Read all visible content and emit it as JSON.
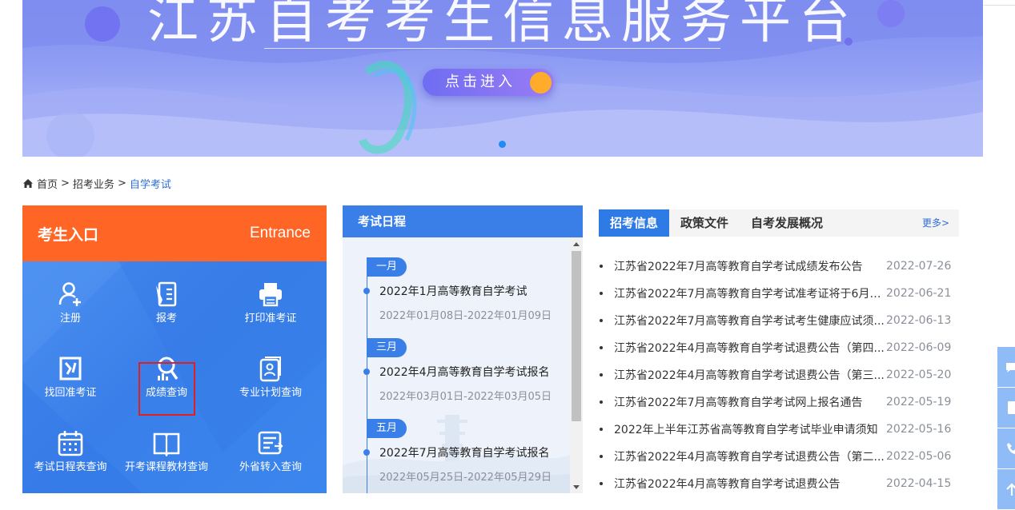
{
  "banner": {
    "title": "江苏自考考生信息服务平台",
    "enter_label": "点击进入"
  },
  "breadcrumb": {
    "items": [
      "首页",
      "招考业务",
      "自学考试"
    ],
    "separator": ">"
  },
  "entrance": {
    "title_cn": "考生入口",
    "title_en": "Entrance",
    "header_color": "#ff6625",
    "body_color": "#3d86ec",
    "tiles": [
      {
        "label": "注册",
        "icon": "user-add-icon"
      },
      {
        "label": "报考",
        "icon": "form-pen-icon"
      },
      {
        "label": "打印准考证",
        "icon": "printer-icon"
      },
      {
        "label": "找回准考证",
        "icon": "retrieve-ticket-icon"
      },
      {
        "label": "成绩查询",
        "icon": "score-search-icon"
      },
      {
        "label": "专业计划查询",
        "icon": "plan-doc-icon"
      },
      {
        "label": "考试日程表查询",
        "icon": "calendar-icon"
      },
      {
        "label": "开考课程教材查询",
        "icon": "book-icon"
      },
      {
        "label": "外省转入查询",
        "icon": "transfer-icon"
      }
    ]
  },
  "schedule": {
    "title": "考试日程",
    "events": [
      {
        "month": "一月",
        "title": "2022年1月高等教育自学考试",
        "date": "2022年01月08日-2022年01月09日"
      },
      {
        "month": "三月",
        "title": "2022年4月高等教育自学考试报名",
        "date": "2022年03月01日-2022年03月05日"
      },
      {
        "month": "五月",
        "title": "2022年7月高等教育自学考试报名",
        "date": "2022年05月25日-2022年05月29日"
      }
    ]
  },
  "news": {
    "tabs": [
      "招考信息",
      "政策文件",
      "自考发展概况"
    ],
    "more_label": "更多>",
    "items": [
      {
        "title": "江苏省2022年7月高等教育自学考试成绩发布公告",
        "date": "2022-07-26"
      },
      {
        "title": "江苏省2022年7月高等教育自学考试准考证将于6月2...",
        "date": "2022-06-21"
      },
      {
        "title": "江苏省2022年7月高等教育自学考试考生健康应试须...",
        "date": "2022-06-13"
      },
      {
        "title": "江苏省2022年4月高等教育自学考试退费公告（第四...",
        "date": "2022-06-09"
      },
      {
        "title": "江苏省2022年4月高等教育自学考试退费公告（第三...",
        "date": "2022-05-20"
      },
      {
        "title": "江苏省2022年7月高等教育自学考试网上报名通告",
        "date": "2022-05-19"
      },
      {
        "title": "2022年上半年江苏省高等教育自学考试毕业申请须知",
        "date": "2022-05-16"
      },
      {
        "title": "江苏省2022年4月高等教育自学考试退费公告（第二...",
        "date": "2022-05-06"
      },
      {
        "title": "江苏省2022年4月高等教育自学考试退费公告",
        "date": "2022-04-15"
      }
    ]
  },
  "colors": {
    "accent_blue": "#3a7fe8",
    "link_blue": "#2f6fd8",
    "orange": "#ff6625",
    "selected_outline": "#e02020"
  }
}
